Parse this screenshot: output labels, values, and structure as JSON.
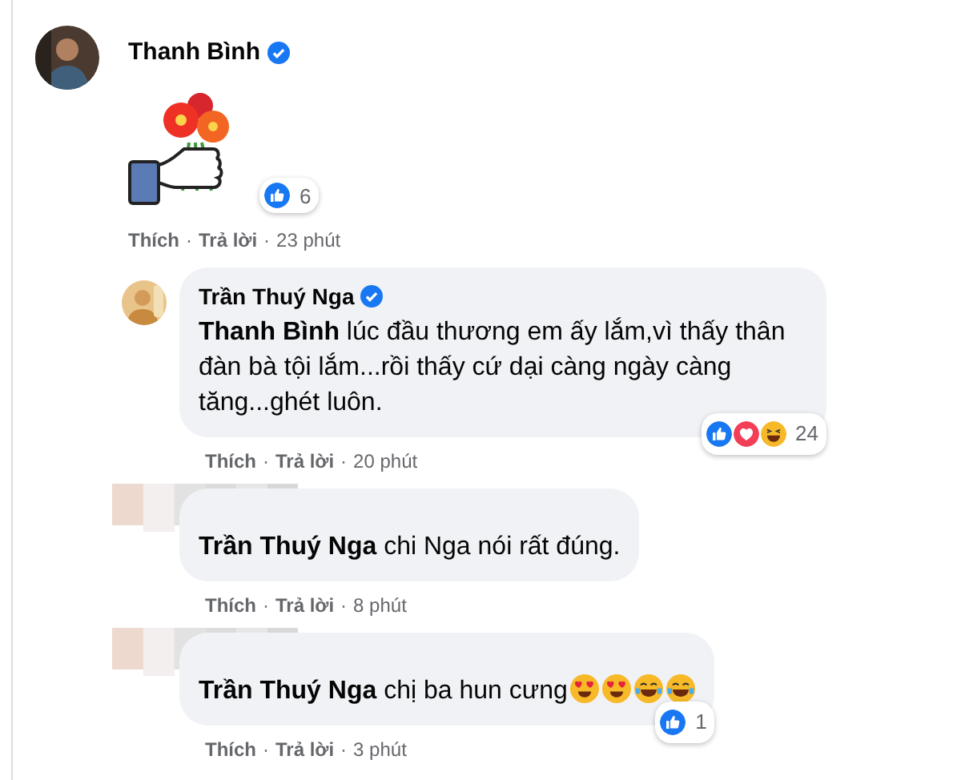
{
  "comment": {
    "author": "Thanh Bình",
    "verified": true,
    "kind": "sticker",
    "reactions": {
      "icons": [
        {
          "kind": "like"
        }
      ],
      "count": "6"
    },
    "actions": [
      {
        "kind": "link",
        "text": "Thích"
      },
      {
        "kind": "dot",
        "text": "·"
      },
      {
        "kind": "link",
        "text": "Trả lời"
      },
      {
        "kind": "dot",
        "text": "·"
      },
      {
        "kind": "time",
        "text": "23 phút"
      }
    ],
    "replies": [
      {
        "author": "Trần Thuý Nga",
        "author_hidden": false,
        "verified": true,
        "text": "**Thanh Bình** lúc đầu thương em ấy lắm,vì thấy thân đàn bà tội lắm...rồi thấy cứ dại càng ngày càng tăng...ghét luôn.",
        "reactions": {
          "icons": [
            {
              "kind": "like"
            },
            {
              "kind": "love"
            },
            {
              "kind": "haha"
            }
          ],
          "count": "24"
        },
        "actions": [
          {
            "kind": "link",
            "text": "Thích"
          },
          {
            "kind": "dot",
            "text": "·"
          },
          {
            "kind": "link",
            "text": "Trả lời"
          },
          {
            "kind": "dot",
            "text": "·"
          },
          {
            "kind": "time",
            "text": "20 phút"
          }
        ]
      },
      {
        "author_hidden": true,
        "text": "**Trần Thuý Nga** chi Nga nói rất đúng.",
        "actions": [
          {
            "kind": "link",
            "text": "Thích"
          },
          {
            "kind": "dot",
            "text": "·"
          },
          {
            "kind": "link",
            "text": "Trả lời"
          },
          {
            "kind": "dot",
            "text": "·"
          },
          {
            "kind": "time",
            "text": "8 phút"
          }
        ]
      },
      {
        "author_hidden": true,
        "text": "**Trần Thuý Nga** chị ba hun cưng",
        "emojis": [
          {
            "kind": "heart_eyes"
          },
          {
            "kind": "heart_eyes"
          },
          {
            "kind": "joy"
          },
          {
            "kind": "joy"
          }
        ],
        "reactions": {
          "icons": [
            {
              "kind": "like"
            }
          ],
          "count": "1"
        },
        "actions": [
          {
            "kind": "link",
            "text": "Thích"
          },
          {
            "kind": "dot",
            "text": "·"
          },
          {
            "kind": "link",
            "text": "Trả lời"
          },
          {
            "kind": "dot",
            "text": "·"
          },
          {
            "kind": "time",
            "text": "3 phút"
          }
        ]
      }
    ]
  }
}
